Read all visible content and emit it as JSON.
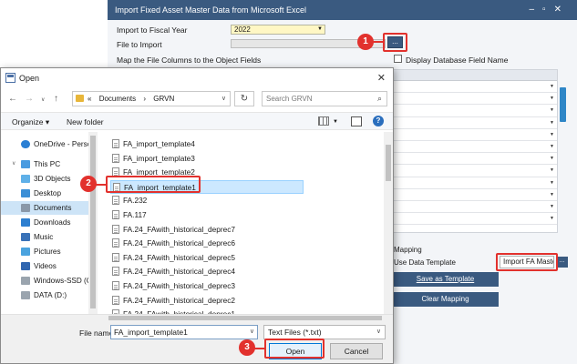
{
  "sap": {
    "title": "Import Fixed Asset Master Data from Microsoft Excel",
    "fiscal_year_label": "Import to Fiscal Year",
    "fiscal_year_value": "2022",
    "file_label": "File to Import",
    "browse_label": "...",
    "map_label": "Map the File Columns to the Object Fields",
    "display_field_label": "Display Database Field Name",
    "mapping_label": "Mapping",
    "use_template_label": "Use Data Template",
    "template_value": "Import FA Maste",
    "template_browse": "...",
    "save_template_label": "Save as Template",
    "clear_mapping_label": "Clear Mapping",
    "accent_color": "#3a5a80"
  },
  "dialog": {
    "title": "Open",
    "close_icon": "close-icon",
    "address": {
      "segments": [
        "Documents",
        "GRVN"
      ],
      "separator": "›",
      "prefix": "«"
    },
    "search_placeholder": "Search GRVN",
    "organize_label": "Organize ▾",
    "new_folder_label": "New folder",
    "nav_items": [
      {
        "label": "OneDrive - Person",
        "icon": "cloud-icon"
      },
      {
        "label": "This PC",
        "icon": "computer-icon"
      },
      {
        "label": "3D Objects",
        "icon": "cube-icon"
      },
      {
        "label": "Desktop",
        "icon": "desktop-icon"
      },
      {
        "label": "Documents",
        "icon": "documents-icon",
        "selected": true
      },
      {
        "label": "Downloads",
        "icon": "download-icon"
      },
      {
        "label": "Music",
        "icon": "music-icon"
      },
      {
        "label": "Pictures",
        "icon": "pictures-icon"
      },
      {
        "label": "Videos",
        "icon": "videos-icon"
      },
      {
        "label": "Windows-SSD (C",
        "icon": "drive-icon"
      },
      {
        "label": "DATA (D:)",
        "icon": "drive-icon"
      }
    ],
    "files": [
      "FA_import_template4",
      "FA_import_template3",
      "FA_import_template2",
      "FA_import_template1",
      "FA.232",
      "FA.117",
      "FA.24_FAwith_historical_deprec7",
      "FA.24_FAwith_historical_deprec6",
      "FA.24_FAwith_historical_deprec5",
      "FA.24_FAwith_historical_deprec4",
      "FA.24_FAwith_historical_deprec3",
      "FA.24_FAwith_historical_deprec2",
      "FA.24_FAwith_historical_deprec1"
    ],
    "selected_file_index": 3,
    "file_name_label": "File name:",
    "file_name_value": "FA_import_template1",
    "file_type_value": "Text Files (*.txt)",
    "open_label": "Open",
    "cancel_label": "Cancel"
  },
  "callouts": [
    "1",
    "2",
    "3"
  ],
  "callout_color": "#e2312d"
}
